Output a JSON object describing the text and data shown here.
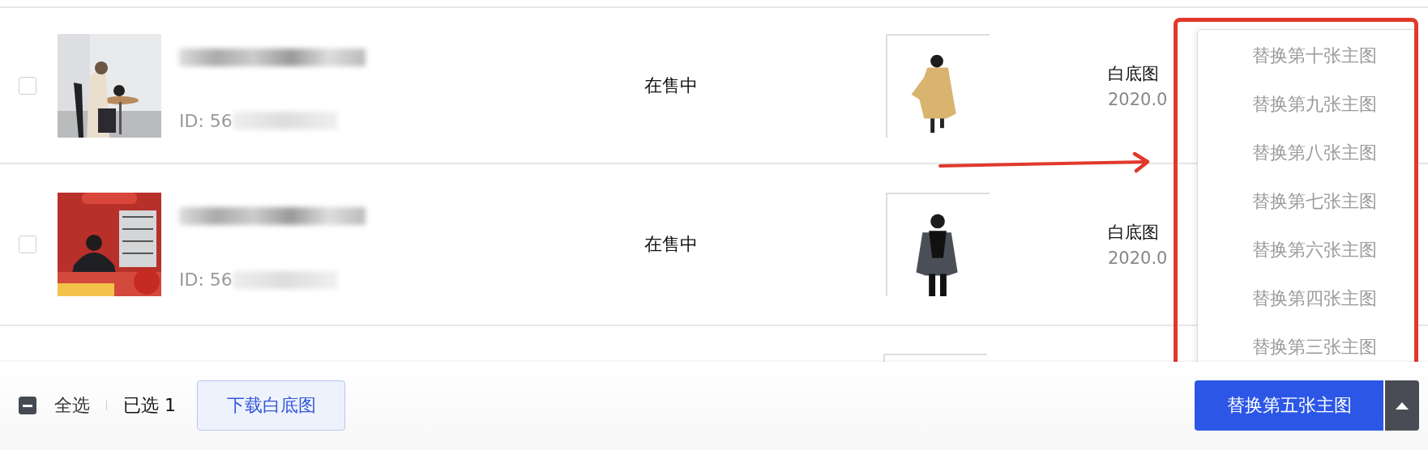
{
  "rows": [
    {
      "checked": false,
      "id": "ID: 56",
      "status": "在售中",
      "white_label": "白底图",
      "date": "2020.0"
    },
    {
      "checked": false,
      "id": "ID: 56",
      "status": "在售中",
      "white_label": "白底图",
      "date": "2020.0"
    }
  ],
  "menu": {
    "open": true,
    "items": [
      "替换第十张主图",
      "替换第九张主图",
      "替换第八张主图",
      "替换第七张主图",
      "替换第六张主图",
      "替换第四张主图",
      "替换第三张主图"
    ]
  },
  "footer": {
    "select_all": {
      "label": "全选",
      "indeterminate": true
    },
    "selected_count": "已选 1",
    "download_button": "下载白底图",
    "replace_button": "替换第五张主图"
  }
}
